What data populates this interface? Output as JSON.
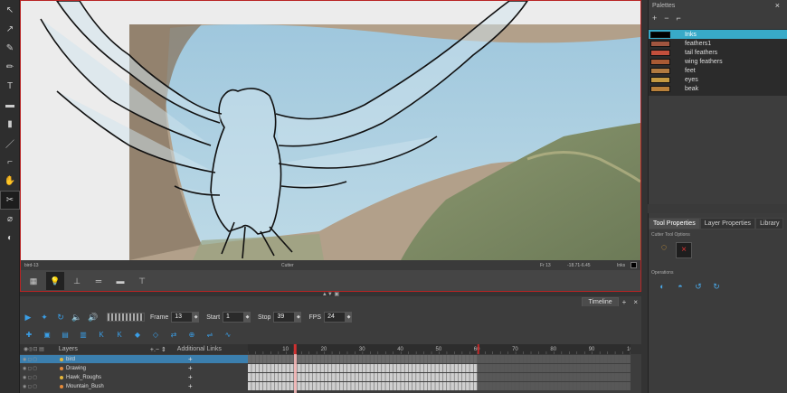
{
  "toolbar": {
    "tools": [
      {
        "name": "select-tool",
        "glyph": "↖"
      },
      {
        "name": "contour-editor-tool",
        "glyph": "↗"
      },
      {
        "name": "brush-tool",
        "glyph": "✎"
      },
      {
        "name": "pencil-tool",
        "glyph": "✏"
      },
      {
        "name": "text-tool",
        "glyph": "T"
      },
      {
        "name": "eraser-tool",
        "glyph": "▬"
      },
      {
        "name": "paint-tool",
        "glyph": "▮"
      },
      {
        "name": "line-tool",
        "glyph": "／"
      },
      {
        "name": "dropper-tool",
        "glyph": "⌐"
      },
      {
        "name": "hand-tool",
        "glyph": "✋"
      },
      {
        "name": "cutter-tool",
        "glyph": "✂"
      },
      {
        "name": "zoom-tool",
        "glyph": "⌀"
      },
      {
        "name": "morph-tool",
        "glyph": "◐"
      }
    ]
  },
  "viewport": {
    "status_left": "bird-13",
    "status_center": "Cutter",
    "status_frame": "Fr 13",
    "status_coords": "-18.71-6.45",
    "status_ink": "Inks"
  },
  "timeline": {
    "tab_label": "Timeline",
    "frame_label": "Frame",
    "frame_value": "13",
    "start_label": "Start",
    "start_value": "1",
    "stop_label": "Stop",
    "stop_value": "39",
    "fps_label": "FPS",
    "fps_value": "24",
    "layers_label": "Layers",
    "additional_links_label": "Additional Links",
    "ruler": [
      "10",
      "20",
      "30",
      "40",
      "50",
      "60",
      "70",
      "80",
      "90",
      "100"
    ],
    "current_frame": 13,
    "stop_frame": 60,
    "layers": [
      {
        "name": "bird",
        "color": "#e6b73a",
        "selected": true
      },
      {
        "name": "Drawing",
        "color": "#e68a3a",
        "selected": false
      },
      {
        "name": "Hawk_Roughs",
        "color": "#e6b73a",
        "selected": false
      },
      {
        "name": "Mountain_Bush",
        "color": "#e68a3a",
        "selected": false
      }
    ]
  },
  "palettes": {
    "title": "Palettes",
    "colors": [
      {
        "name": "Inks",
        "hex": "#000000",
        "selected": true
      },
      {
        "name": "feathers1",
        "hex": "#a0553f",
        "selected": false
      },
      {
        "name": "tail feathers",
        "hex": "#c24f3c",
        "selected": false
      },
      {
        "name": "wing feathers",
        "hex": "#a85a34",
        "selected": false
      },
      {
        "name": "feet",
        "hex": "#b07a40",
        "selected": false
      },
      {
        "name": "eyes",
        "hex": "#c49a42",
        "selected": false
      },
      {
        "name": "beak",
        "hex": "#b8803a",
        "selected": false
      }
    ]
  },
  "properties": {
    "tabs": [
      "Tool Properties",
      "Layer Properties",
      "Library"
    ],
    "options_label": "Cutter Tool Options",
    "operations_label": "Operations"
  }
}
